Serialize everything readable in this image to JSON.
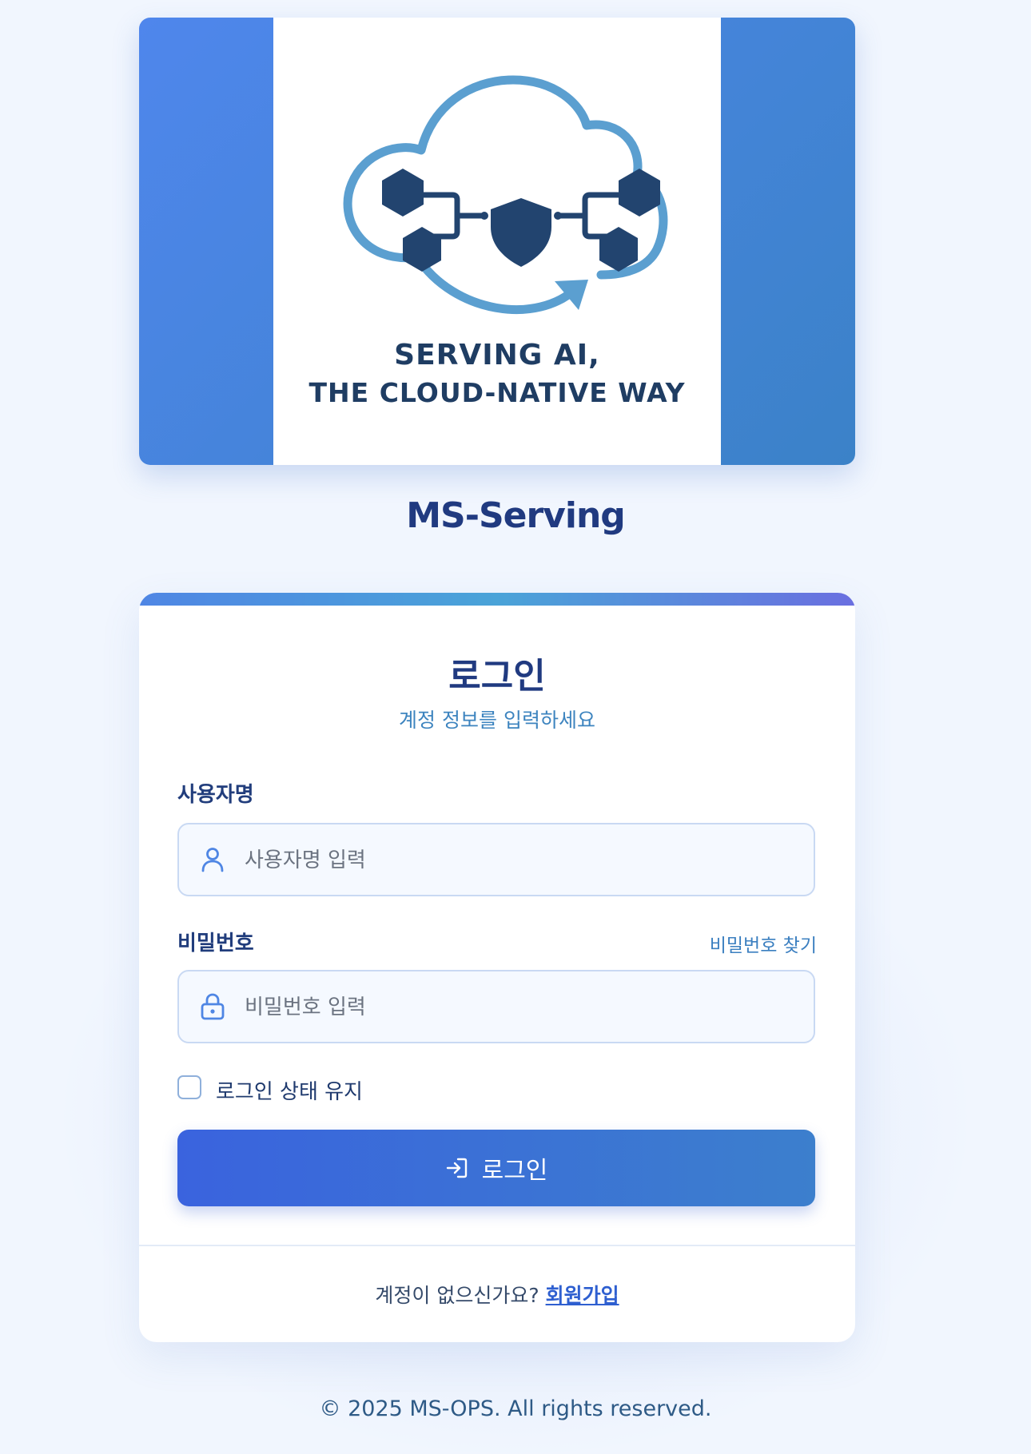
{
  "hero": {
    "tagline_line1": "SERVING AI,",
    "tagline_line2": "THE CLOUD-NATIVE WAY"
  },
  "brand": {
    "name": "MS-Serving"
  },
  "login": {
    "title": "로그인",
    "subtitle": "계정 정보를 입력하세요",
    "username_label": "사용자명",
    "username_placeholder": "사용자명 입력",
    "username_value": "",
    "password_label": "비밀번호",
    "forgot_password": "비밀번호 찾기",
    "password_placeholder": "비밀번호 입력",
    "password_value": "",
    "remember_me": "로그인 상태 유지",
    "remember_me_checked": false,
    "submit_label": "로그인"
  },
  "footer": {
    "no_account_text": "계정이 없으신가요?",
    "signup_link": "회원가입"
  },
  "copyright": "© 2025 MS-OPS. All rights reserved.",
  "icons": {
    "username": "user-icon",
    "password": "lock-icon",
    "submit": "login-arrow-icon"
  },
  "colors": {
    "primary": "#3a63de",
    "title": "#203a80",
    "accent": "#3d84bf",
    "background": "#f1f6fe",
    "logo_dark": "#1f3d63",
    "logo_light": "#5b9fd0"
  }
}
